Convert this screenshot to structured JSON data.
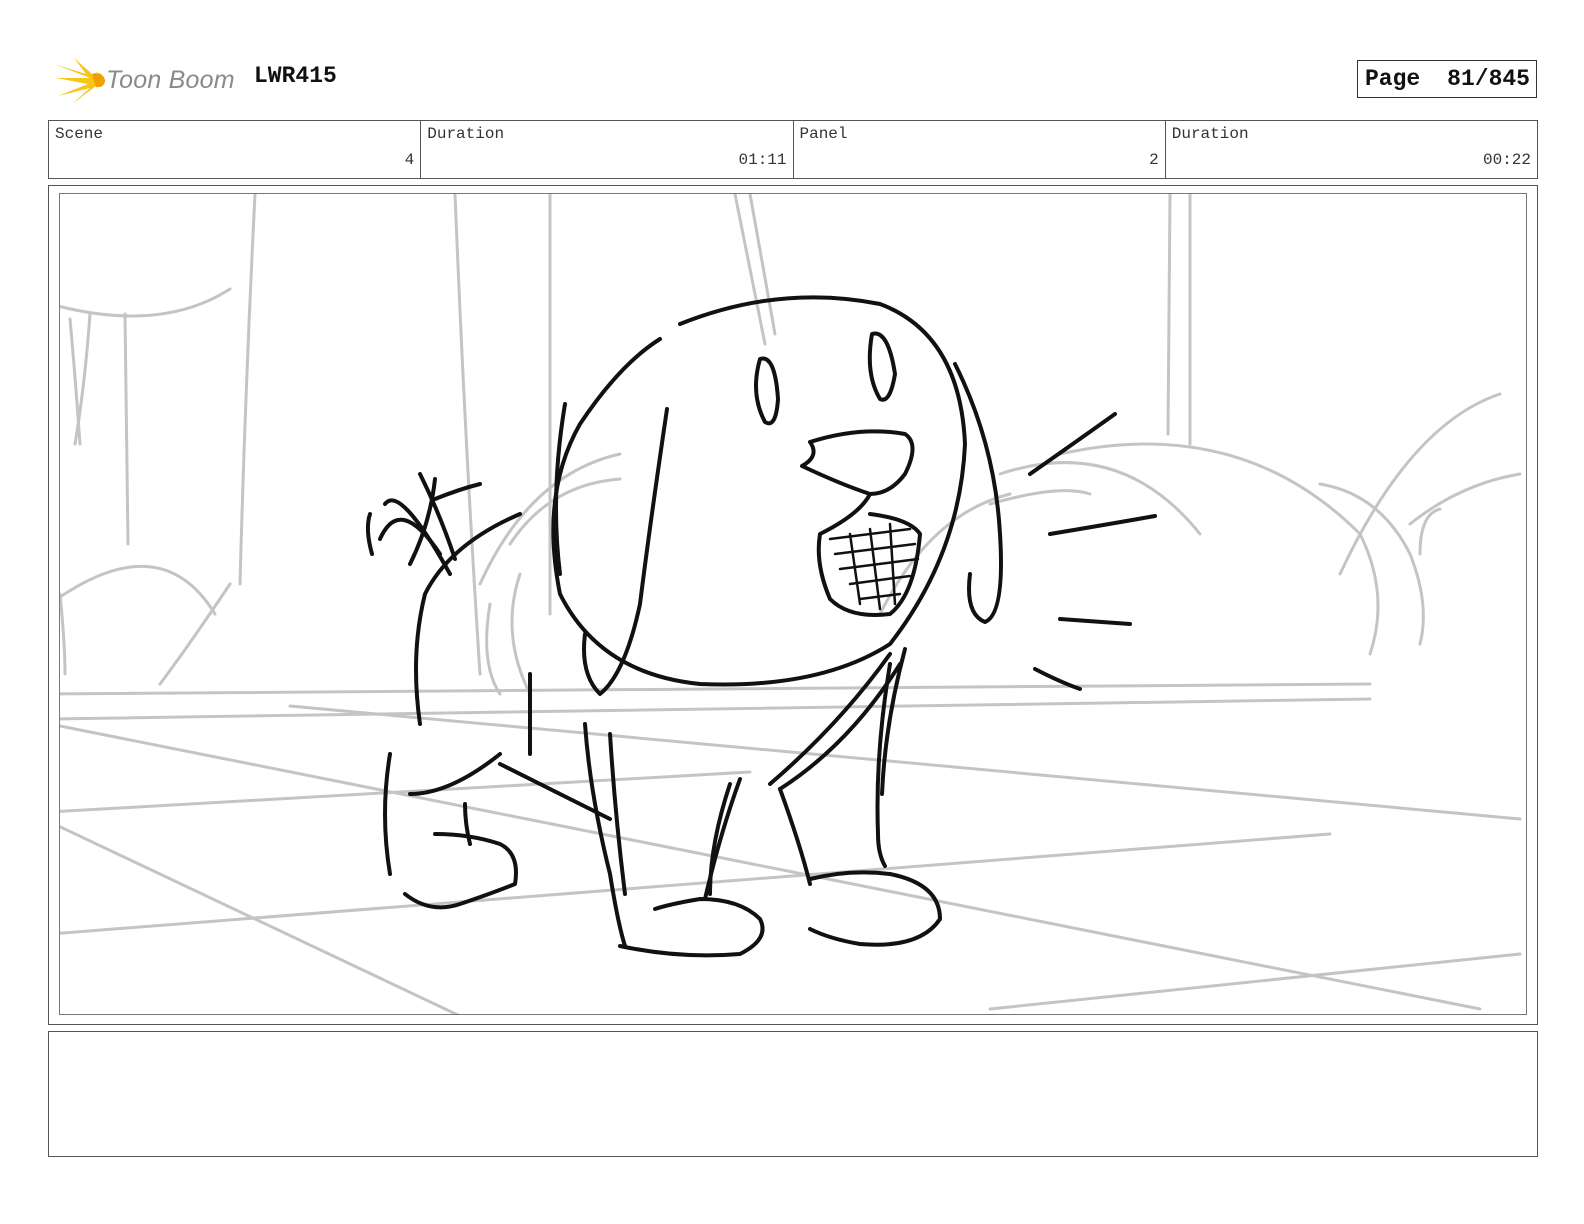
{
  "header": {
    "logo_text": "Toon Boom",
    "logo_icon": "starburst-logo-icon",
    "project_id": "LWR415",
    "page_label": "Page",
    "page_value": "81/845"
  },
  "info": {
    "scene": {
      "label": "Scene",
      "value": "4"
    },
    "scene_duration": {
      "label": "Duration",
      "value": "01:11"
    },
    "panel": {
      "label": "Panel",
      "value": "2"
    },
    "panel_duration": {
      "label": "Duration",
      "value": "00:22"
    }
  },
  "panel_image": {
    "subject": "dog-sketch",
    "background": "forest-sketch"
  },
  "notes": {
    "text": ""
  },
  "colors": {
    "logo_yellow": "#f5c518",
    "logo_orange": "#f0a000",
    "sketch_ink": "#111111",
    "background_sketch": "#c4c4c4"
  }
}
